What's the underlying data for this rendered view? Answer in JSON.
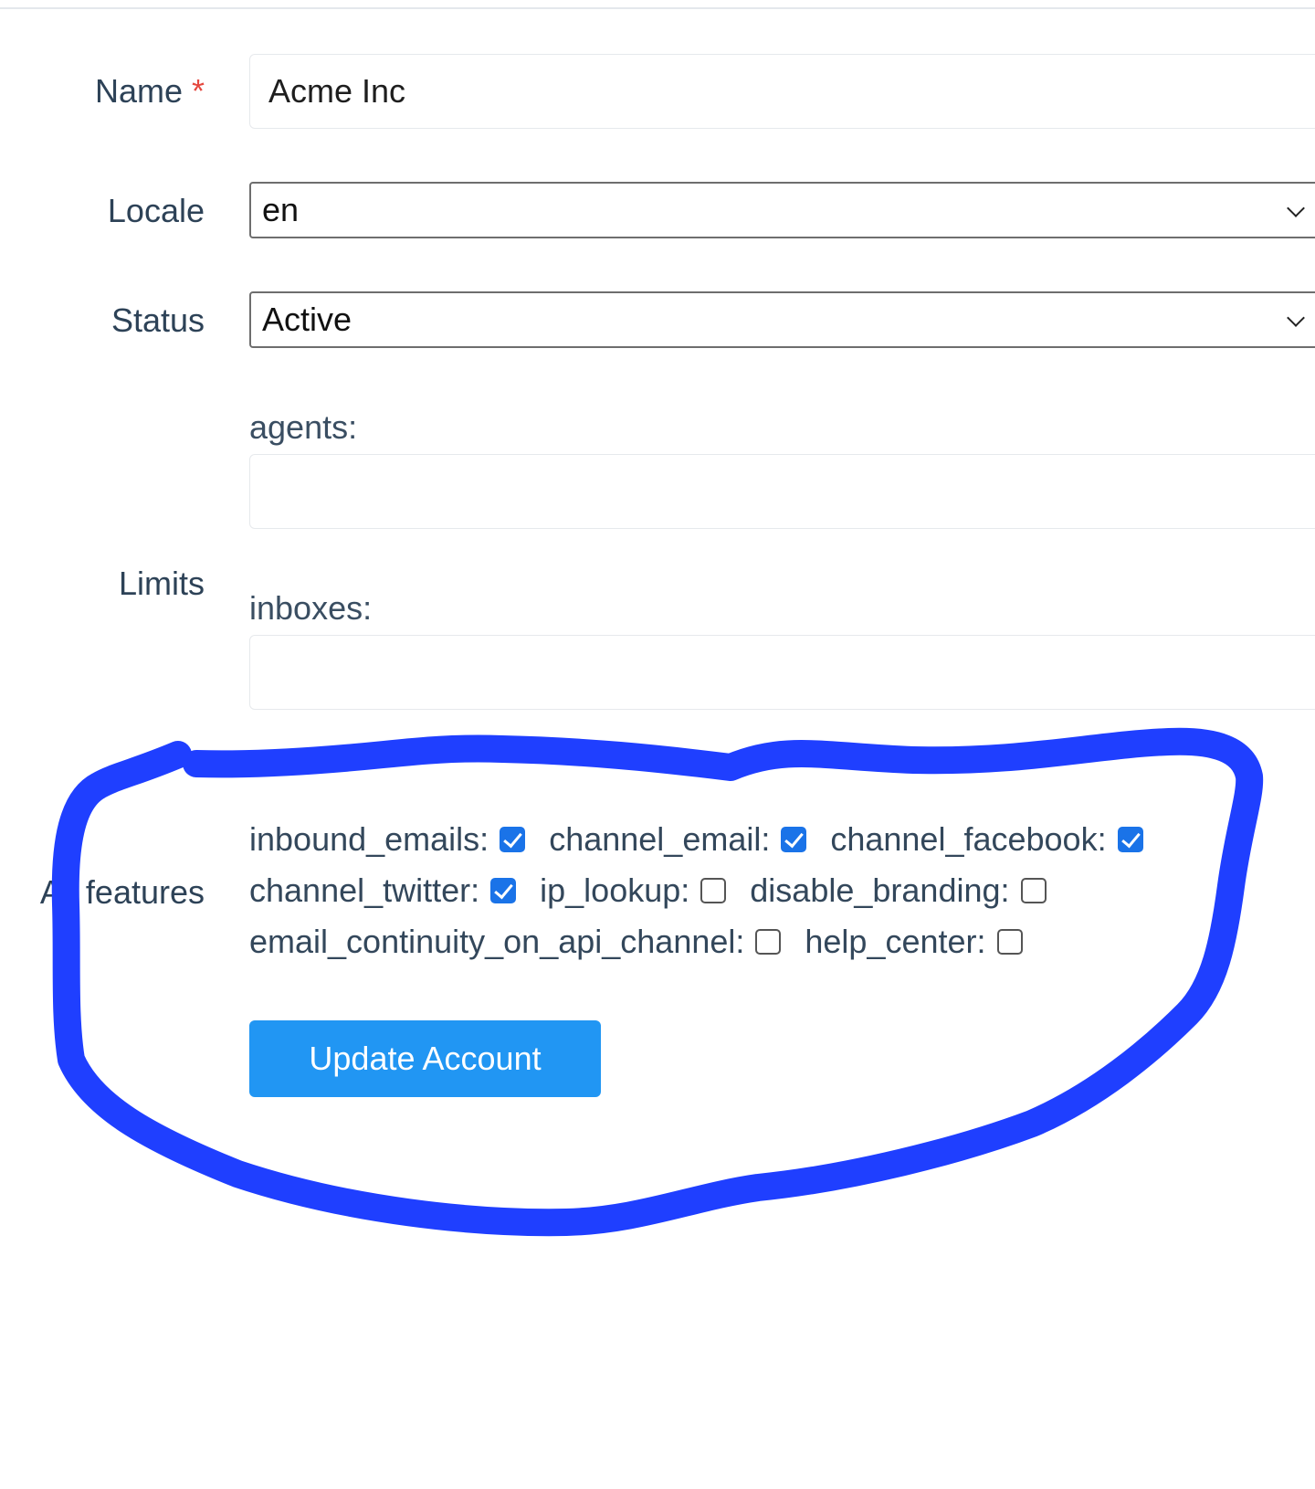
{
  "form": {
    "name": {
      "label": "Name",
      "required_mark": "*",
      "value": "Acme Inc"
    },
    "locale": {
      "label": "Locale",
      "value": "en"
    },
    "status": {
      "label": "Status",
      "value": "Active"
    },
    "limits": {
      "label": "Limits",
      "agents": {
        "label": "agents:",
        "value": ""
      },
      "inboxes": {
        "label": "inboxes:",
        "value": ""
      }
    },
    "features": {
      "label": "All features",
      "items": [
        {
          "label": "inbound_emails:",
          "checked": true
        },
        {
          "label": "channel_email:",
          "checked": true
        },
        {
          "label": "channel_facebook:",
          "checked": true
        },
        {
          "label": "channel_twitter:",
          "checked": true
        },
        {
          "label": "ip_lookup:",
          "checked": false
        },
        {
          "label": "disable_branding:",
          "checked": false
        },
        {
          "label": "email_continuity_on_api_channel:",
          "checked": false
        },
        {
          "label": "help_center:",
          "checked": false
        }
      ]
    },
    "submit_label": "Update Account"
  },
  "colors": {
    "accent": "#2196f3",
    "checkbox_checked": "#1a73e8",
    "required": "#e5483f",
    "annotation_stroke": "#1f3fff"
  },
  "icons": {
    "select_indicator": "chevron-down-icon",
    "checkbox_checked": "checkmark-icon"
  }
}
